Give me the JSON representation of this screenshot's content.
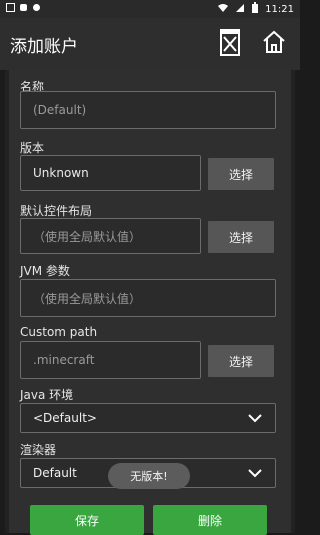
{
  "status_bar": {
    "time": "11:21",
    "left_icons": [
      "app-icon",
      "app-icon",
      "app-icon"
    ],
    "right_icons": [
      "wifi-icon",
      "signal-icon",
      "battery-icon"
    ]
  },
  "appbar": {
    "title": "添加账户",
    "actions": [
      {
        "name": "delete-icon"
      },
      {
        "name": "home-icon"
      }
    ]
  },
  "form": {
    "name": {
      "label": "名称",
      "placeholder": "(Default)"
    },
    "version": {
      "label": "版本",
      "value": "Unknown",
      "pick": "选择"
    },
    "controls": {
      "label": "默认控件布局",
      "placeholder": "（使用全局默认值）",
      "pick": "选择"
    },
    "jvm": {
      "label": "JVM 参数",
      "placeholder": "（使用全局默认值）"
    },
    "custom_path": {
      "label": "Custom path",
      "placeholder": ".minecraft",
      "pick": "选择"
    },
    "java_env": {
      "label": "Java 环境",
      "selected": "<Default>"
    },
    "renderer": {
      "label": "渲染器",
      "selected": "Default"
    }
  },
  "toast": {
    "text": "无版本!"
  },
  "buttons": {
    "save": "保存",
    "delete": "删除"
  },
  "colors": {
    "accent": "#3aa640",
    "background": "#1b1b1b"
  }
}
